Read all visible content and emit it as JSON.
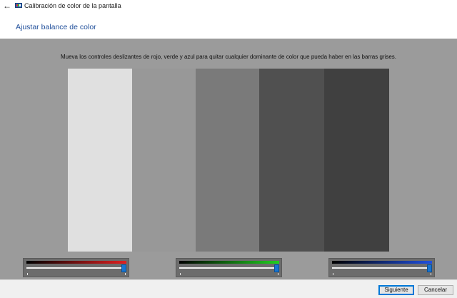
{
  "window": {
    "title": "Calibración de color de la pantalla",
    "back_icon": "arrow-left-icon",
    "app_icon": "monitor-color-icon"
  },
  "header": {
    "title": "Ajustar balance de color"
  },
  "main": {
    "instructions": "Mueva los controles deslizantes de rojo, verde y azul para quitar cualquier dominante de color que pueda haber en las barras grises.",
    "background_color": "#9b9b9b",
    "gray_bars": [
      "#e0e0e0",
      "#989898",
      "#7a7a7a",
      "#505050",
      "#404040"
    ]
  },
  "sliders": [
    {
      "name": "red",
      "color": "#e02020",
      "value": 1.0
    },
    {
      "name": "green",
      "color": "#20d020",
      "value": 1.0
    },
    {
      "name": "blue",
      "color": "#2050e0",
      "value": 1.0
    }
  ],
  "footer": {
    "next_label": "Siguiente",
    "cancel_label": "Cancelar"
  }
}
